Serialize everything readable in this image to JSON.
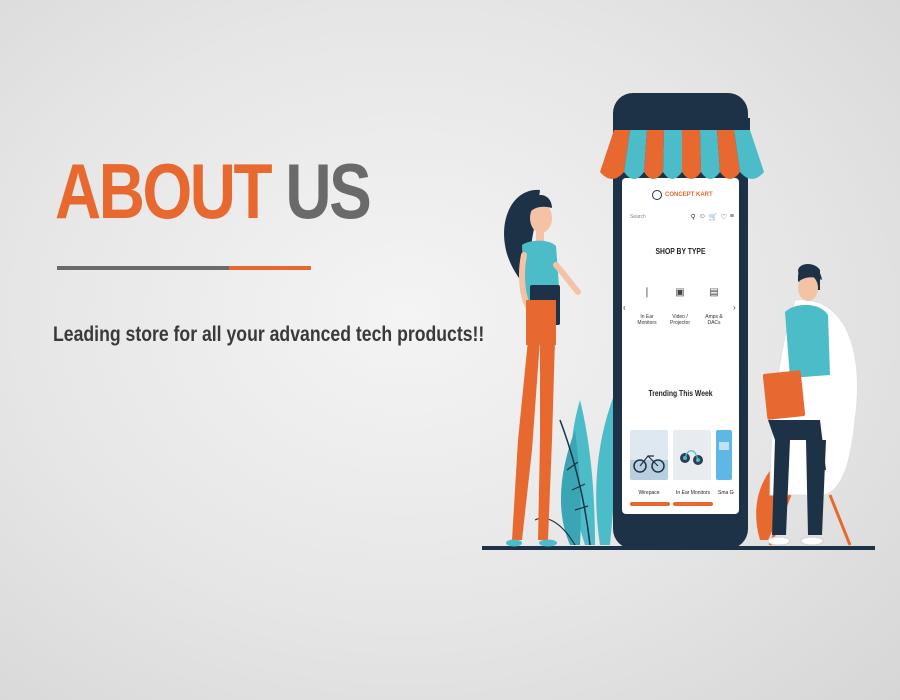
{
  "heading": {
    "word1": "ABOUT",
    "word2": "US"
  },
  "tagline": "Leading store for all your advanced tech products!!",
  "phone": {
    "brand": "CONCEPT KART",
    "search_label": "Search",
    "header_icons": [
      "search-icon",
      "user-icon",
      "cart-icon",
      "wishlist-icon",
      "menu-icon"
    ],
    "shop_title": "SHOP BY TYPE",
    "categories": [
      {
        "line1": "In Ear",
        "line2": "Monitors",
        "icon": "earphones-icon"
      },
      {
        "line1": "Video /",
        "line2": "Projector",
        "icon": "projector-icon"
      },
      {
        "line1": "Amps &",
        "line2": "DACs",
        "icon": "amplifier-icon"
      }
    ],
    "trending_title": "Trending This Week",
    "products": [
      {
        "label": "Wirepace"
      },
      {
        "label": "In Ear Monitors"
      },
      {
        "label": "Sma Ge"
      }
    ]
  },
  "colors": {
    "accent": "#e8692f",
    "heading_gray": "#6a6a6a",
    "phone_body": "#1d3247",
    "teal": "#4cbcc9"
  }
}
